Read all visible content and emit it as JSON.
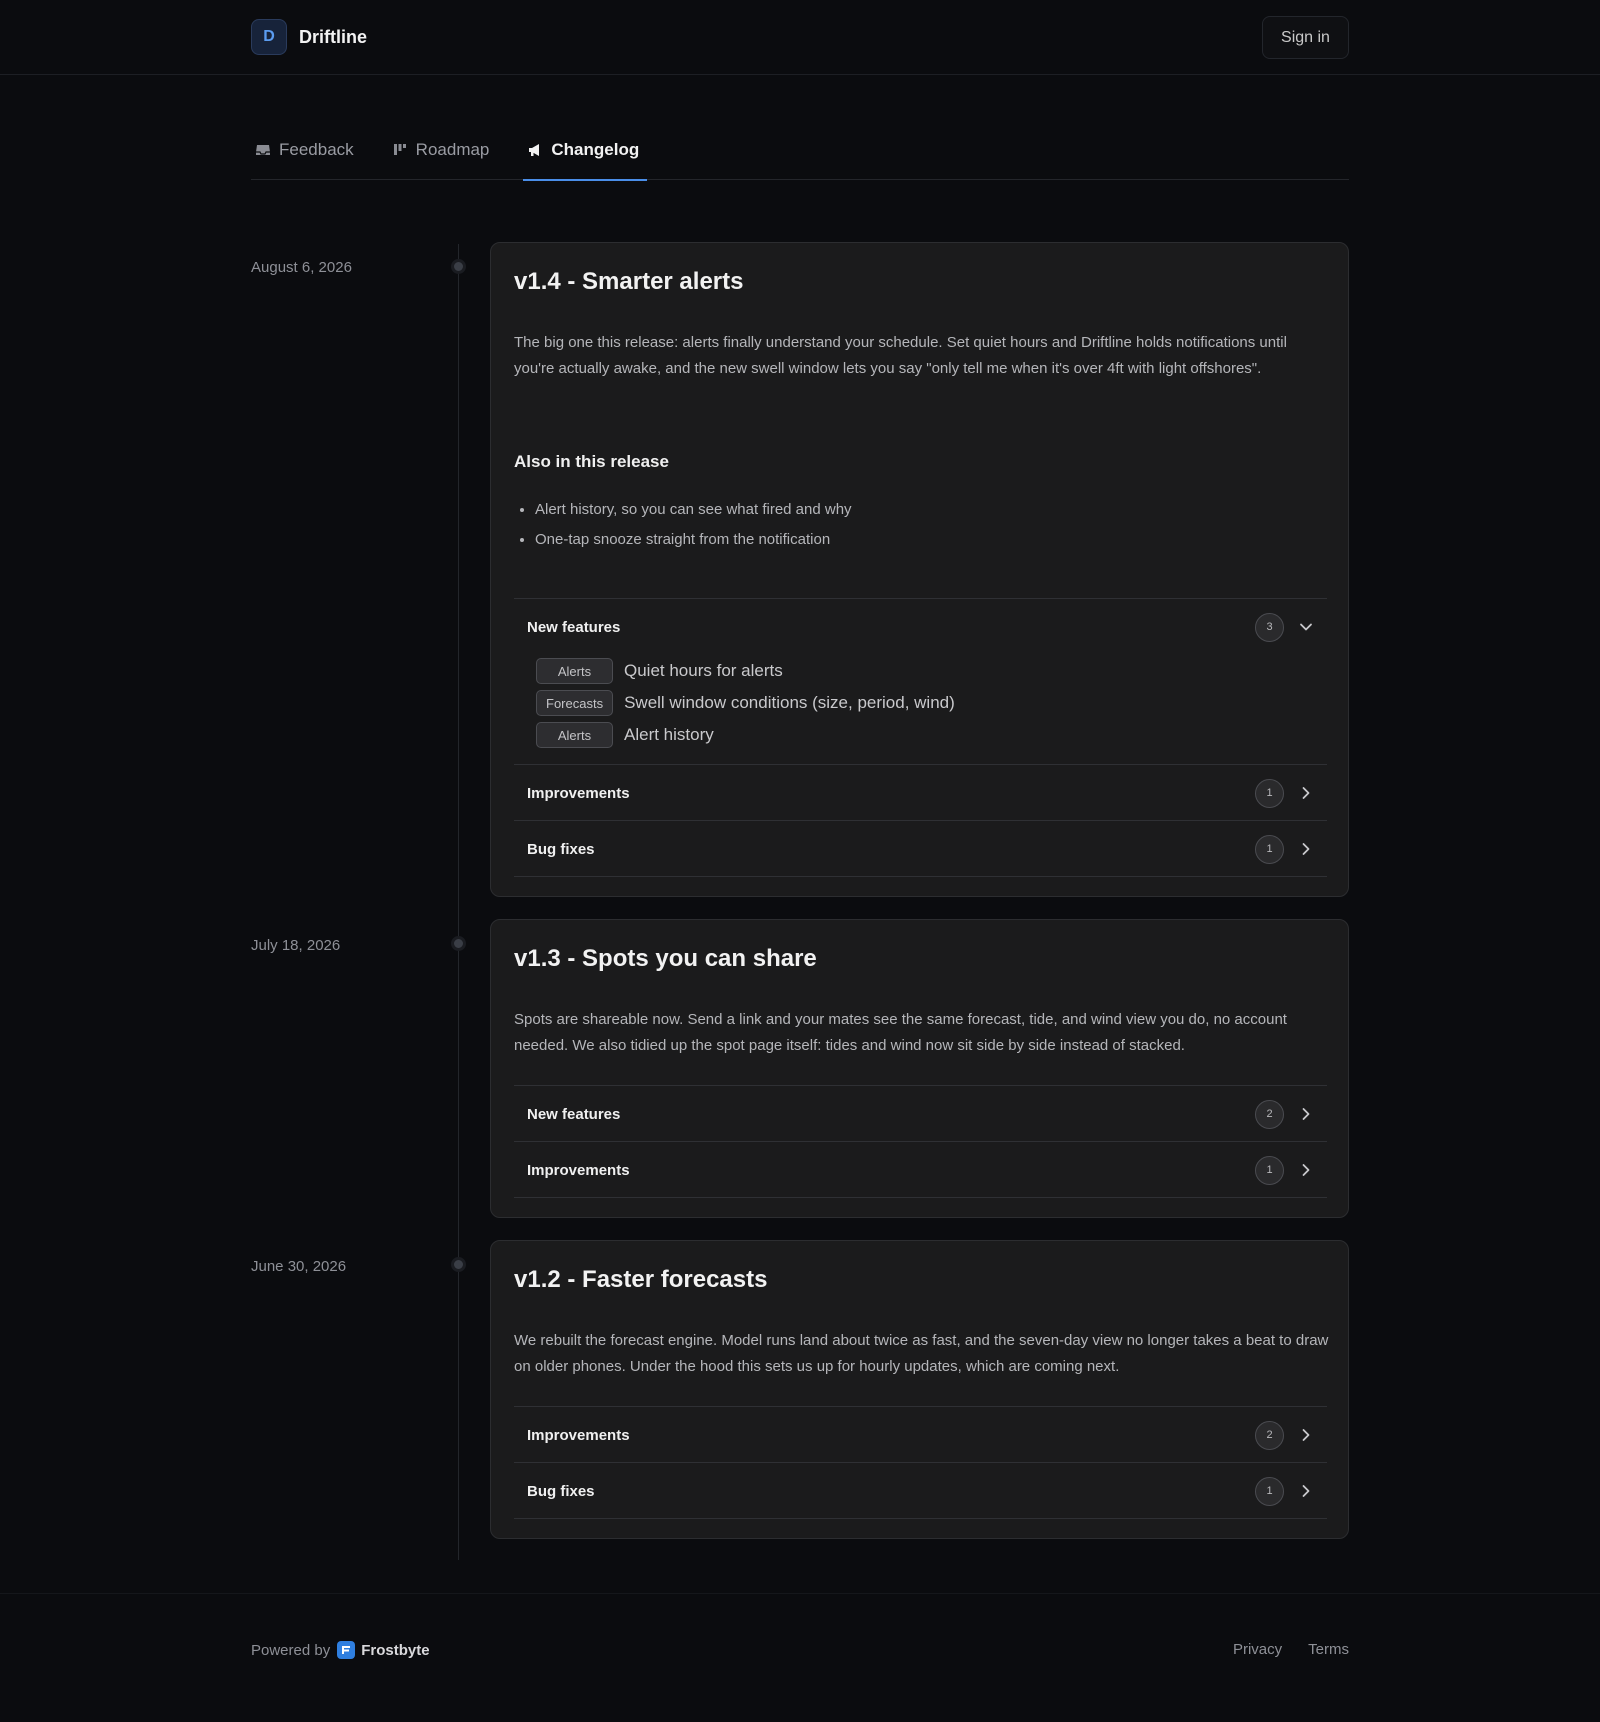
{
  "header": {
    "logo_letter": "D",
    "brand": "Driftline",
    "signin_label": "Sign in"
  },
  "tabs": [
    {
      "label": "Feedback",
      "icon": "inbox-icon",
      "active": false
    },
    {
      "label": "Roadmap",
      "icon": "roadmap-icon",
      "active": false
    },
    {
      "label": "Changelog",
      "icon": "megaphone-icon",
      "active": true
    }
  ],
  "releases": [
    {
      "date": "August 6, 2026",
      "title": "v1.4 - Smarter alerts",
      "description": "The big one this release: alerts finally understand your schedule. Set quiet hours and Driftline holds notifications until you're actually awake, and the new swell window lets you say \"only tell me when it's over 4ft with light offshores\".",
      "subheading": "Also in this release",
      "bullets": [
        "Alert history, so you can see what fired and why",
        "One-tap snooze straight from the notification"
      ],
      "sections": [
        {
          "title": "New features",
          "count": "3",
          "expanded": true,
          "items": [
            {
              "tag": "Alerts",
              "text": "Quiet hours for alerts"
            },
            {
              "tag": "Forecasts",
              "text": "Swell window conditions (size, period, wind)"
            },
            {
              "tag": "Alerts",
              "text": "Alert history"
            }
          ]
        },
        {
          "title": "Improvements",
          "count": "1",
          "expanded": false
        },
        {
          "title": "Bug fixes",
          "count": "1",
          "expanded": false
        }
      ]
    },
    {
      "date": "July 18, 2026",
      "title": "v1.3 - Spots you can share",
      "description": "Spots are shareable now. Send a link and your mates see the same forecast, tide, and wind view you do, no account needed. We also tidied up the spot page itself: tides and wind now sit side by side instead of stacked.",
      "sections": [
        {
          "title": "New features",
          "count": "2",
          "expanded": false
        },
        {
          "title": "Improvements",
          "count": "1",
          "expanded": false
        }
      ]
    },
    {
      "date": "June 30, 2026",
      "title": "v1.2 - Faster forecasts",
      "description": "We rebuilt the forecast engine. Model runs land about twice as fast, and the seven-day view no longer takes a beat to draw on older phones. Under the hood this sets us up for hourly updates, which are coming next.",
      "sections": [
        {
          "title": "Improvements",
          "count": "2",
          "expanded": false
        },
        {
          "title": "Bug fixes",
          "count": "1",
          "expanded": false
        }
      ]
    }
  ],
  "footer": {
    "powered_by": "Powered by",
    "provider": "Frostbyte",
    "links": [
      "Privacy",
      "Terms"
    ]
  },
  "colors": {
    "background": "#0b0c0f",
    "card": "#1b1b1c",
    "accent": "#4a8ee8"
  }
}
